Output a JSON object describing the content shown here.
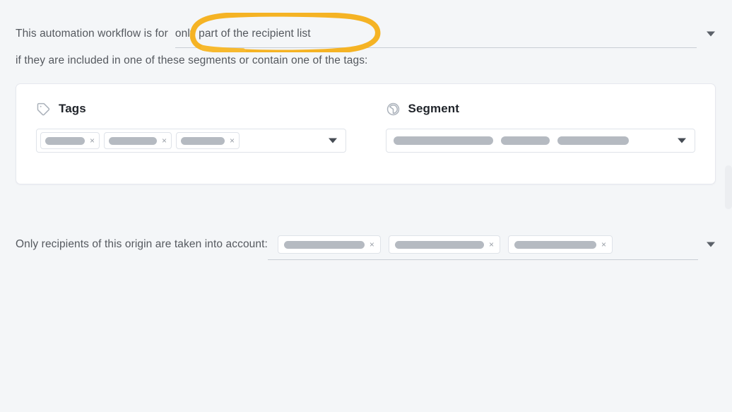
{
  "statement": {
    "lead_text": "This automation workflow is for",
    "selected_value": "only part of the recipient list",
    "dropdown_icon": "chevron-down-icon",
    "sub_text": "if they are included in one of these segments or contain one of the tags:"
  },
  "card": {
    "tags": {
      "title": "Tags",
      "icon": "tag-icon",
      "chips": [
        {
          "redacted_width": 56,
          "remove_label": "×"
        },
        {
          "redacted_width": 68,
          "remove_label": "×"
        },
        {
          "redacted_width": 62,
          "remove_label": "×"
        }
      ],
      "dropdown_icon": "chevron-down-icon"
    },
    "segment": {
      "title": "Segment",
      "icon": "segment-circle-icon",
      "bars": [
        {
          "redacted_width": 141
        },
        {
          "redacted_width": 69
        },
        {
          "redacted_width": 101
        }
      ],
      "dropdown_icon": "chevron-down-icon"
    }
  },
  "origin": {
    "label": "Only recipients of this origin are taken into account:",
    "chips": [
      {
        "redacted_width": 114,
        "remove_label": "×"
      },
      {
        "redacted_width": 126,
        "remove_label": "×"
      },
      {
        "redacted_width": 116,
        "remove_label": "×"
      }
    ],
    "dropdown_icon": "chevron-down-icon"
  },
  "annotation": {
    "type": "hand-drawn-ellipse-highlight",
    "target": "only part of the recipient list",
    "color": "#f5b324"
  },
  "colors": {
    "page_background": "#f4f6f8",
    "card_background": "#ffffff",
    "card_border": "#e6e8ee",
    "text": "#55595f",
    "heading": "#21252b",
    "redacted_bar": "#b5bac1",
    "field_border": "#dfe3e9",
    "underline": "#c9ced4",
    "annotation": "#f5b324",
    "scrollbar_thumb": "#eceef1"
  }
}
